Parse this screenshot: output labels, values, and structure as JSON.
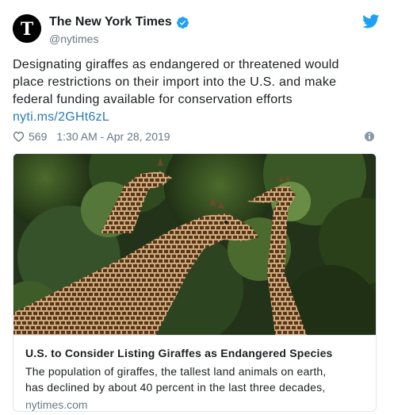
{
  "author": {
    "name": "The New York Times",
    "handle": "@nytimes"
  },
  "tweet": {
    "text_lines": [
      "Designating giraffes as endangered or threatened would",
      "place restrictions on their import into the U.S. and make",
      "federal funding available for conservation efforts"
    ],
    "link": "nyti.ms/2GHt6zL",
    "likes": "569",
    "timestamp": "1:30 AM - Apr 28, 2019"
  },
  "card": {
    "title": "U.S. to Consider Listing Giraffes as Endangered Species",
    "description_lines": [
      "The population of giraffes, the tallest land animals on earth,",
      "has declined by about 40 percent in the last three decades,"
    ],
    "domain": "nytimes.com"
  },
  "icons": {
    "avatar": "nyt-logo-icon",
    "verified": "verified-badge-icon",
    "brand": "twitter-bird-icon",
    "like": "heart-icon",
    "info": "info-icon"
  },
  "colors": {
    "link": "#2b7bb9",
    "verified": "#1da1f2",
    "twitter": "#1da1f2",
    "secondary_text": "#697882",
    "border": "#e1e8ed"
  }
}
